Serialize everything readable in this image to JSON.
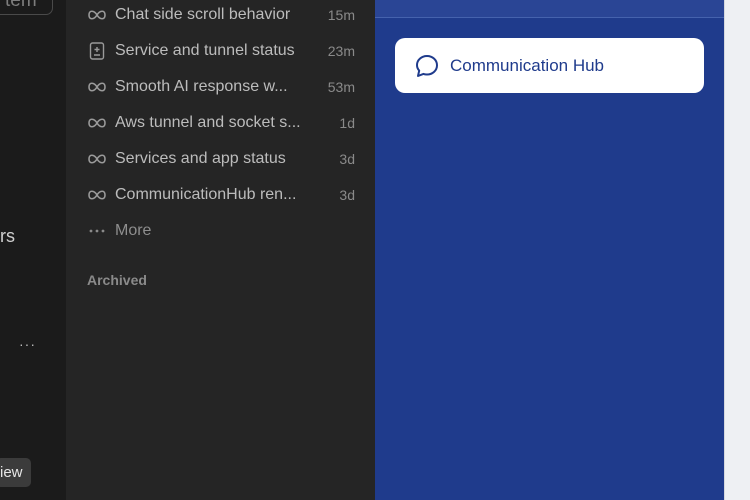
{
  "left_fragment": {
    "top_text": "tem",
    "mid_text": "rs",
    "dots": "···",
    "bottom_button": "iew"
  },
  "chats": [
    {
      "icon": "infinity-icon",
      "title": "Chat side scroll behavior",
      "time": "15m"
    },
    {
      "icon": "document-plus-icon",
      "title": "Service and tunnel status",
      "time": "23m"
    },
    {
      "icon": "infinity-icon",
      "title": "Smooth AI response w...",
      "time": "53m"
    },
    {
      "icon": "infinity-icon",
      "title": "Aws tunnel and socket s...",
      "time": "1d"
    },
    {
      "icon": "infinity-icon",
      "title": "Services and app status",
      "time": "3d"
    },
    {
      "icon": "infinity-icon",
      "title": "CommunicationHub ren...",
      "time": "3d"
    }
  ],
  "more": {
    "icon": "ellipsis-icon",
    "label": "More"
  },
  "archived_label": "Archived",
  "hub_card": {
    "icon": "chat-bubble-icon",
    "label": "Communication Hub"
  },
  "colors": {
    "panel_bg": "#252525",
    "blue_bg": "#1f3b8c",
    "card_bg": "#ffffff",
    "accent_text": "#1f3b8c"
  }
}
